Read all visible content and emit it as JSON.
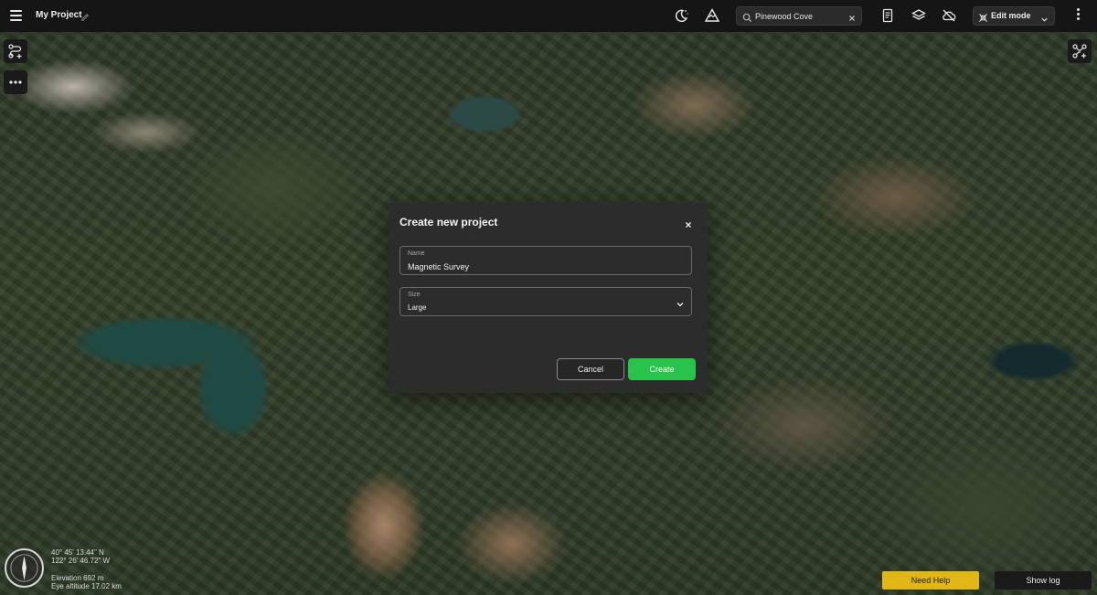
{
  "header": {
    "project_name": "My Project",
    "search": {
      "value": "Pinewood Cove"
    },
    "mode": {
      "selected": "Edit mode"
    }
  },
  "icons": {
    "menu": "hamburger-icon",
    "edit": "pencil-icon",
    "night": "moon-icon",
    "terrain": "terrain-triangle-icon",
    "search": "search-icon",
    "clear": "close-icon",
    "notes": "document-icon",
    "layers": "layers-icon",
    "cloud": "cloud-off-icon",
    "mode": "edit-mode-icon",
    "more": "kebab-icon",
    "route": "route-add-icon",
    "options": "ellipsis-icon",
    "drone": "drone-add-icon",
    "compass": "compass-icon"
  },
  "modal": {
    "title": "Create new project",
    "name_field": {
      "label": "Name",
      "value": "Magnetic Survey"
    },
    "size_field": {
      "label": "Size",
      "value": "Large"
    },
    "cancel_label": "Cancel",
    "create_label": "Create"
  },
  "status": {
    "latitude": "40° 45' 13.44\" N",
    "longitude": "122° 26' 46.72\" W",
    "elevation": "Elevation 692 m",
    "eye_altitude": "Eye altitude 17.02 km"
  },
  "footer": {
    "help_label": "Need Help",
    "log_label": "Show log"
  },
  "colors": {
    "topbar": "#151515",
    "modal_bg": "#2c2c2c",
    "create_button": "#27c34a",
    "help_button": "#e0b714",
    "log_button": "#1a1a1a"
  }
}
